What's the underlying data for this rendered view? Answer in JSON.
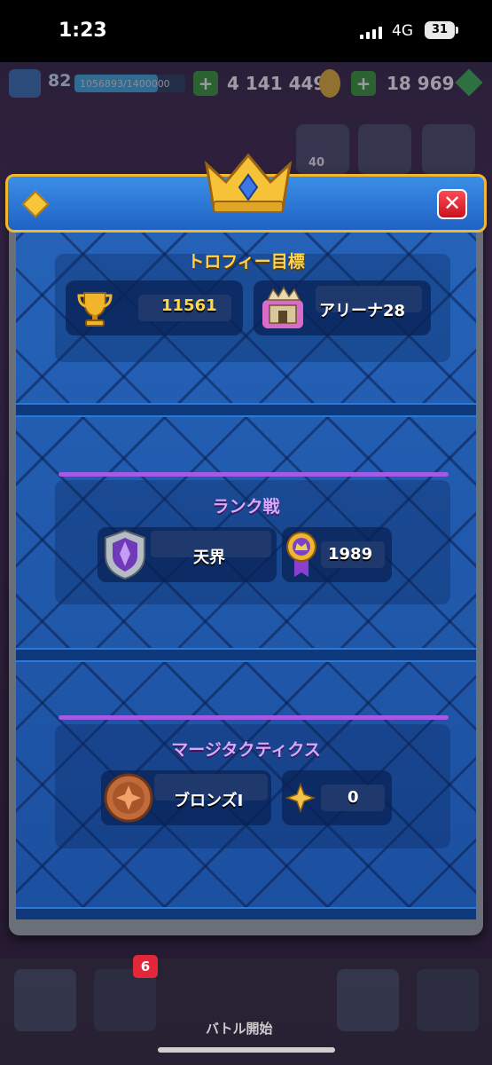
{
  "status_bar": {
    "time": "1:23",
    "network": "4G",
    "battery": "31"
  },
  "resources": {
    "level": "82",
    "xp_text": "1056893/1400000",
    "xp_progress": 0.755,
    "gold": "4 141 449",
    "gems": "18 969"
  },
  "top_buttons": {
    "friends_count": "40"
  },
  "dialog": {
    "trophy_section": {
      "title": "トロフィー目標",
      "trophies": "11561",
      "arena": "アリーナ28"
    },
    "ranked_section": {
      "title": "ランク戦",
      "league": "天界",
      "rating": "1989"
    },
    "merge_tactics_section": {
      "title": "マージタクティクス",
      "league": "ブロンズI",
      "points": "0"
    }
  },
  "bottom_nav": {
    "cards_badge": "6",
    "battle_label": "バトル開始"
  },
  "colors": {
    "accent_gold": "#ffd24a",
    "dialog_blue": "#1f62c4",
    "purple": "#a45ae6"
  }
}
